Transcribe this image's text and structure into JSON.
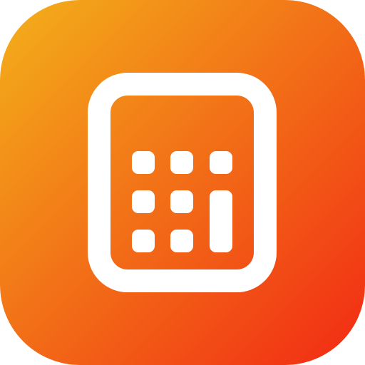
{
  "icon": {
    "name": "calculator-icon",
    "gradient": {
      "start": "#F3B01A",
      "end": "#F22A14"
    },
    "glyph_color": "#FFFFFF"
  }
}
